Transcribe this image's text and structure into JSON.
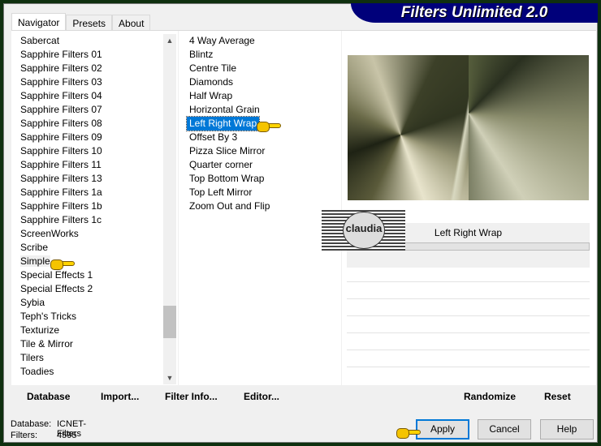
{
  "title": "Filters Unlimited 2.0",
  "tabs": [
    "Navigator",
    "Presets",
    "About"
  ],
  "categories": [
    "Sabercat",
    "Sapphire Filters 01",
    "Sapphire Filters 02",
    "Sapphire Filters 03",
    "Sapphire Filters 04",
    "Sapphire Filters 07",
    "Sapphire Filters 08",
    "Sapphire Filters 09",
    "Sapphire Filters 10",
    "Sapphire Filters 11",
    "Sapphire Filters 13",
    "Sapphire Filters 1a",
    "Sapphire Filters 1b",
    "Sapphire Filters 1c",
    "ScreenWorks",
    "Scribe",
    "Simple",
    "Special Effects 1",
    "Special Effects 2",
    "Sybia",
    "Teph's Tricks",
    "Texturize",
    "Tile & Mirror",
    "Tilers",
    "Toadies"
  ],
  "filters": [
    "4 Way Average",
    "Blintz",
    "Centre Tile",
    "Diamonds",
    "Half Wrap",
    "Horizontal Grain",
    "Left Right Wrap",
    "Offset By 3",
    "Pizza Slice Mirror",
    "Quarter corner",
    "Top Bottom Wrap",
    "Top Left Mirror",
    "Zoom Out and Flip"
  ],
  "selected_filter": "Left Right Wrap",
  "selected_category": "Simple",
  "param_title": "Left Right Wrap",
  "watermark": "claudia",
  "left_buttons": [
    "Database",
    "Import...",
    "Filter Info...",
    "Editor..."
  ],
  "right_buttons": [
    "Randomize",
    "Reset"
  ],
  "status": {
    "db_label": "Database:",
    "db_value": "ICNET-Filters",
    "filters_label": "Filters:",
    "filters_value": "4595"
  },
  "dialog_buttons": {
    "apply": "Apply",
    "cancel": "Cancel",
    "help": "Help"
  },
  "colors": {
    "accent": "#0078d7",
    "banner": "#00007a",
    "frame": "#0f2f0f"
  }
}
